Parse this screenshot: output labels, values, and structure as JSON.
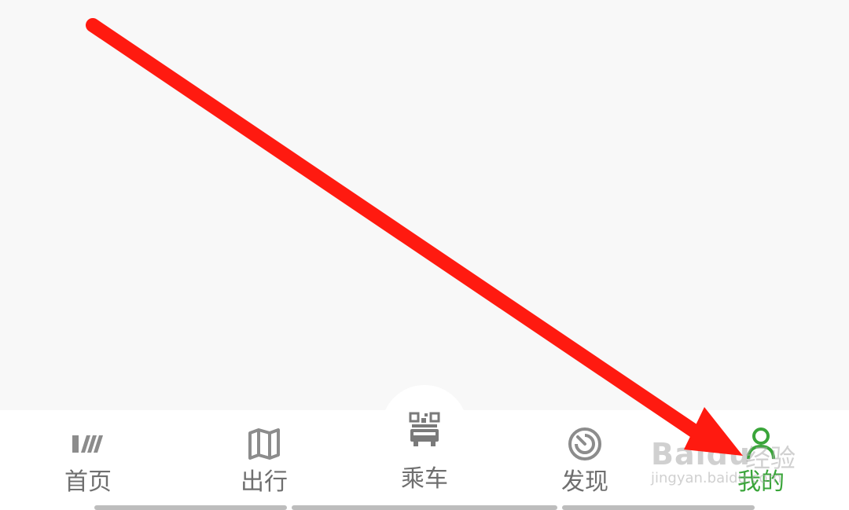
{
  "tabbar": {
    "tabs": [
      {
        "id": "home",
        "label": "首页",
        "icon": "home-stripes-icon",
        "active": false
      },
      {
        "id": "travel",
        "label": "出行",
        "icon": "map-icon",
        "active": false
      },
      {
        "id": "ride",
        "label": "乘车",
        "icon": "qr-bus-icon",
        "active": false
      },
      {
        "id": "find",
        "label": "发现",
        "icon": "radar-icon",
        "active": false
      },
      {
        "id": "mine",
        "label": "我的",
        "icon": "user-icon",
        "active": true
      }
    ]
  },
  "watermark": {
    "logo": "Baidu",
    "tag": "经验",
    "url": "jingyan.baidu.com"
  },
  "colors": {
    "active": "#3aa53a",
    "inactive": "#6f6f6f",
    "icon": "#8c8c8c",
    "arrow": "#ff1a10",
    "background": "#f8f8f8"
  }
}
